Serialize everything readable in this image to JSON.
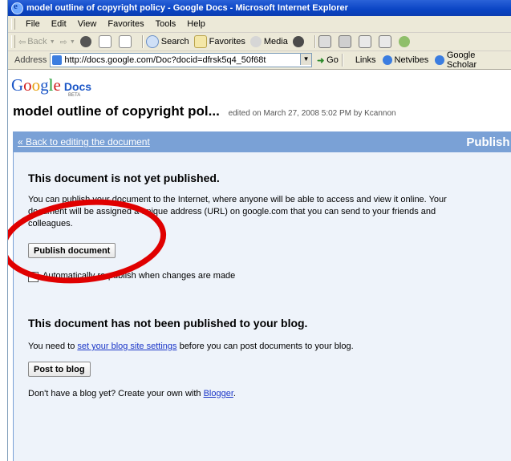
{
  "window": {
    "title": "model outline of copyright policy - Google Docs - Microsoft Internet Explorer"
  },
  "menu": [
    "File",
    "Edit",
    "View",
    "Favorites",
    "Tools",
    "Help"
  ],
  "toolbar": {
    "back": "Back",
    "search": "Search",
    "favorites": "Favorites",
    "media": "Media"
  },
  "address": {
    "label": "Address",
    "url": "http://docs.google.com/Doc?docid=dfrsk5q4_50f68t",
    "go": "Go",
    "links_label": "Links",
    "links": [
      "Netvibes",
      "Google Scholar"
    ]
  },
  "logo": {
    "g1": "G",
    "o1": "o",
    "o2": "o",
    "g2": "g",
    "l": "l",
    "e": "e",
    "docs": "Docs",
    "beta": "BETA"
  },
  "doc": {
    "title": "model outline of copyright pol...",
    "edited": "edited on March 27, 2008 5:02 PM by Kcannon"
  },
  "bar": {
    "back_link": "« Back to editing the document",
    "publish_title": "Publish thi"
  },
  "publish": {
    "heading": "This document is not yet published.",
    "desc_line1": "You can publish your document to the Internet, where anyone will be able to access and view it online. Your",
    "desc_line2": "document will be assigned a unique address (URL) on google.com that you can send to your friends and",
    "desc_line3": "colleagues.",
    "button": "Publish document",
    "auto_republish": "Automatically re-publish when changes are made"
  },
  "blog": {
    "heading": "This document has not been published to your blog.",
    "need_prefix": "You need to ",
    "settings_link": "set your blog site settings",
    "need_suffix": " before you can post documents to your blog.",
    "button": "Post to blog",
    "create_prefix": "Don't have a blog yet? Create your own with ",
    "blogger_link": "Blogger",
    "create_suffix": "."
  },
  "colors": {
    "titlebar": "#0a44c4",
    "bluebar": "#7aa1d6",
    "panel": "#eef3fa",
    "annotation": "#e00000"
  }
}
